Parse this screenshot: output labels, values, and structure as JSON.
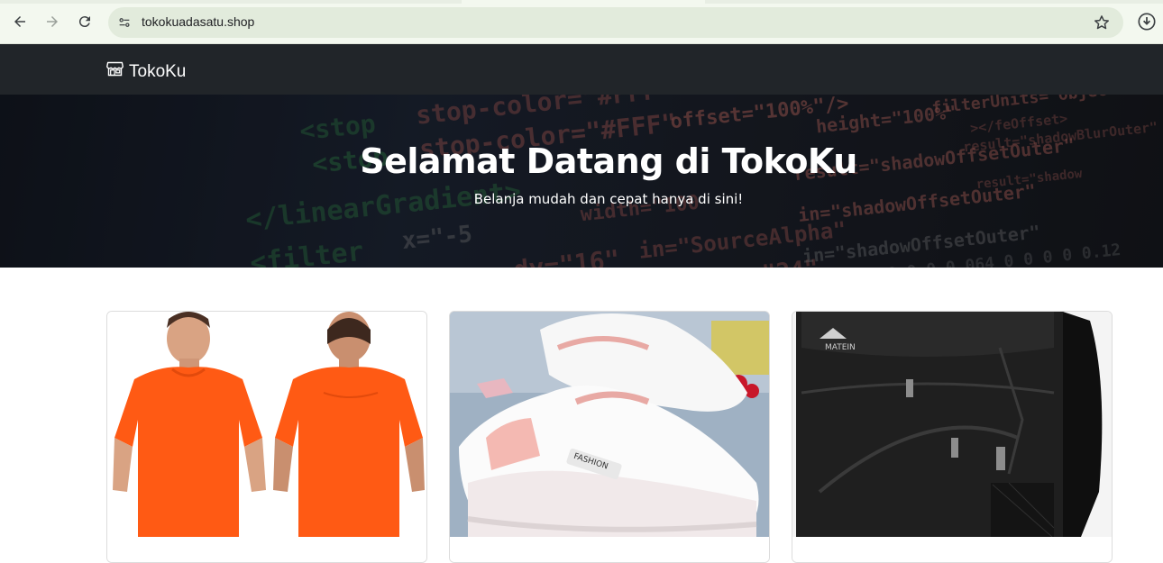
{
  "browser": {
    "url": "tokokuadasatu.shop",
    "icons": [
      "back-icon",
      "forward-icon",
      "reload-icon",
      "site-info-icon",
      "bookmark-star-icon",
      "download-icon"
    ]
  },
  "navbar": {
    "brand_label": "TokoKu",
    "brand_icon": "shop-icon",
    "bg_color": "#212529"
  },
  "hero": {
    "title": "Selamat Datang di TokoKu",
    "subtitle": "Belanja mudah dan cepat hanya di sini!"
  },
  "products": [
    {
      "image": "orange-tshirt-photo",
      "accent": "#ff5a14"
    },
    {
      "image": "white-pink-sneakers-photo",
      "accent": "#f2a7a2"
    },
    {
      "image": "black-backpack-photo",
      "accent": "#1b1b1b"
    }
  ]
}
